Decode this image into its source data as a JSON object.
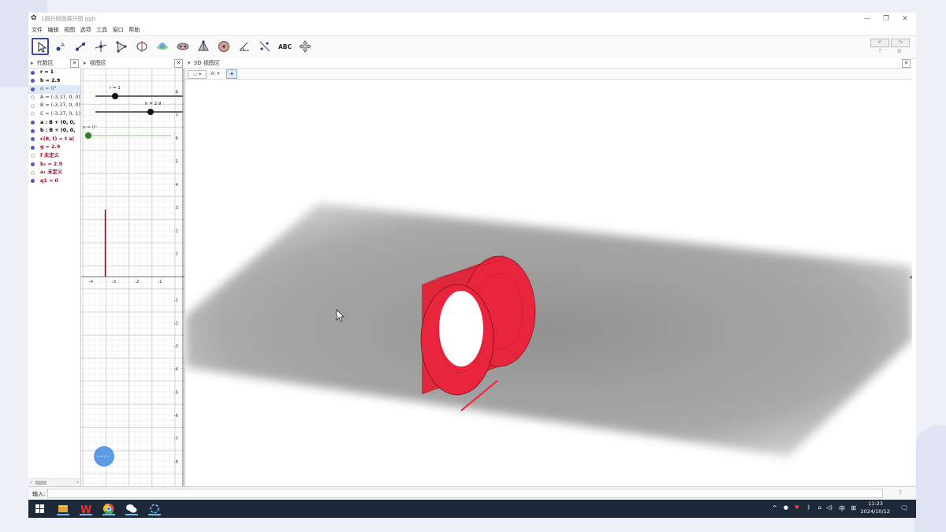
{
  "window": {
    "title": "1圆柱侧面展开图.ggb",
    "controls": {
      "minimize": "—",
      "restore": "❐",
      "close": "✕"
    }
  },
  "menu": [
    "文件",
    "编辑",
    "视图",
    "选项",
    "工具",
    "窗口",
    "帮助"
  ],
  "toolbar": {
    "tools": [
      "move-tool",
      "point-tool",
      "line-tool",
      "perpendicular-tool",
      "polygon-tool",
      "circle-tool",
      "intersect-surfaces-tool",
      "ellipse-tool",
      "pyramid-tool",
      "sphere-tool",
      "angle-tool",
      "reflect-tool",
      "text-tool",
      "move-view-tool"
    ],
    "text_tool_label": "ABC",
    "undo": "↶",
    "redo": "↷",
    "help": "?",
    "settings": "⚙"
  },
  "panels": {
    "algebra_title": "代数区",
    "graphics_title": "视图区",
    "graphics3d_title": "3D 视图区",
    "close": "✕"
  },
  "algebra": {
    "items": [
      {
        "text": "r = 1",
        "color": "#000000",
        "bold": true,
        "dot": "#5a4fcf",
        "filled": true
      },
      {
        "text": "h = 2.9",
        "color": "#000000",
        "bold": true,
        "dot": "#5a4fcf",
        "filled": true
      },
      {
        "text": "α = 0°",
        "color": "#2e7d32",
        "bold": false,
        "dot": "#5a4fcf",
        "filled": true,
        "highlight": true
      },
      {
        "text": "A = (-3.37, 0, 0)",
        "color": "#333333",
        "bold": false,
        "dot": "#bbbbbb",
        "filled": false
      },
      {
        "text": "B = (-3.37, 0, 0)",
        "color": "#333333",
        "bold": false,
        "dot": "#bbbbbb",
        "filled": false
      },
      {
        "text": "C = (-3.37, 0, 1)",
        "color": "#333333",
        "bold": false,
        "dot": "#bbbbbb",
        "filled": false
      },
      {
        "text": "a : B + (0, 0,",
        "color": "#000000",
        "bold": true,
        "dot": "#5a4fcf",
        "filled": true
      },
      {
        "text": "b : B + (0, 0,",
        "color": "#000000",
        "bold": true,
        "dot": "#5a4fcf",
        "filled": true
      },
      {
        "text": "c(θ, t) = t a(",
        "color": "#a0102a",
        "bold": true,
        "dot": "#5a4fcf",
        "filled": true
      },
      {
        "text": "g = 2.9",
        "color": "#a0102a",
        "bold": true,
        "dot": "#5a4fcf",
        "filled": true
      },
      {
        "text": "f 未定义",
        "color": "#a0102a",
        "bold": true,
        "dot": "#bbbbbb",
        "filled": false
      },
      {
        "text": "b₁ = 2.9",
        "color": "#a0102a",
        "bold": true,
        "dot": "#5a4fcf",
        "filled": true
      },
      {
        "text": "a₁ 未定义",
        "color": "#a0102a",
        "bold": true,
        "dot": "#bbbbbb",
        "filled": false
      },
      {
        "text": "q1 = 0",
        "color": "#a0102a",
        "bold": true,
        "dot": "#5a4fcf",
        "filled": true
      }
    ]
  },
  "graphics2d": {
    "slider_r_label": "r = 1",
    "slider_h_label": "h = 2.9",
    "slider_alpha_label": "α = 0°",
    "y_ticks": [
      "8",
      "7",
      "6",
      "5",
      "4",
      "3",
      "2",
      "1",
      "-1",
      "-2",
      "-3",
      "-4",
      "-5",
      "-6",
      "-7",
      "-8"
    ],
    "x_ticks": [
      "-4",
      "-3",
      "-2",
      "-1"
    ],
    "segment_color": "#8b0d1e"
  },
  "graphics3d": {
    "style_buttons": [
      "▭ ▾",
      "A: ▾",
      "✦"
    ],
    "cylinder_color": "#e8253c"
  },
  "input_bar": {
    "label": "输入:",
    "placeholder": "",
    "help": "?"
  },
  "taskbar": {
    "apps": [
      "windows-start-icon",
      "file-explorer-icon",
      "wps-icon",
      "chrome-icon",
      "wechat-icon",
      "screen-recorder-icon"
    ],
    "tray_icons": [
      "^",
      "🎤",
      "📶",
      "🔊",
      "中",
      "⊞"
    ],
    "ime": "中",
    "time": "11:23",
    "date": "2024/10/12",
    "notification": "🗨"
  }
}
